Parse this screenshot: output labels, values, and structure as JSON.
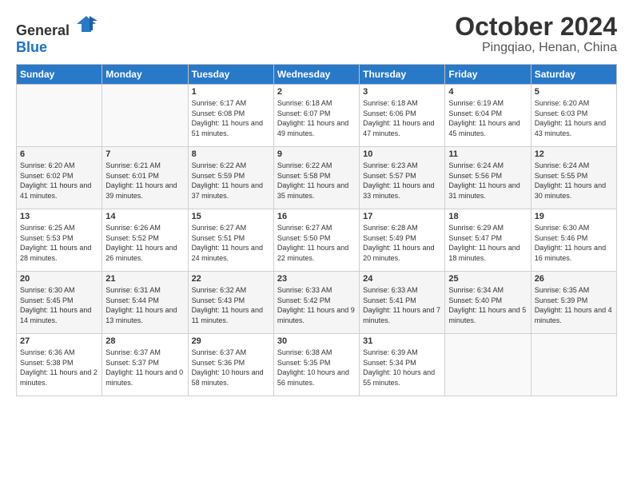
{
  "logo": {
    "general": "General",
    "blue": "Blue"
  },
  "header": {
    "month": "October 2024",
    "location": "Pingqiao, Henan, China"
  },
  "weekdays": [
    "Sunday",
    "Monday",
    "Tuesday",
    "Wednesday",
    "Thursday",
    "Friday",
    "Saturday"
  ],
  "weeks": [
    [
      {
        "day": "",
        "sunrise": "",
        "sunset": "",
        "daylight": ""
      },
      {
        "day": "",
        "sunrise": "",
        "sunset": "",
        "daylight": ""
      },
      {
        "day": "1",
        "sunrise": "Sunrise: 6:17 AM",
        "sunset": "Sunset: 6:08 PM",
        "daylight": "Daylight: 11 hours and 51 minutes."
      },
      {
        "day": "2",
        "sunrise": "Sunrise: 6:18 AM",
        "sunset": "Sunset: 6:07 PM",
        "daylight": "Daylight: 11 hours and 49 minutes."
      },
      {
        "day": "3",
        "sunrise": "Sunrise: 6:18 AM",
        "sunset": "Sunset: 6:06 PM",
        "daylight": "Daylight: 11 hours and 47 minutes."
      },
      {
        "day": "4",
        "sunrise": "Sunrise: 6:19 AM",
        "sunset": "Sunset: 6:04 PM",
        "daylight": "Daylight: 11 hours and 45 minutes."
      },
      {
        "day": "5",
        "sunrise": "Sunrise: 6:20 AM",
        "sunset": "Sunset: 6:03 PM",
        "daylight": "Daylight: 11 hours and 43 minutes."
      }
    ],
    [
      {
        "day": "6",
        "sunrise": "Sunrise: 6:20 AM",
        "sunset": "Sunset: 6:02 PM",
        "daylight": "Daylight: 11 hours and 41 minutes."
      },
      {
        "day": "7",
        "sunrise": "Sunrise: 6:21 AM",
        "sunset": "Sunset: 6:01 PM",
        "daylight": "Daylight: 11 hours and 39 minutes."
      },
      {
        "day": "8",
        "sunrise": "Sunrise: 6:22 AM",
        "sunset": "Sunset: 5:59 PM",
        "daylight": "Daylight: 11 hours and 37 minutes."
      },
      {
        "day": "9",
        "sunrise": "Sunrise: 6:22 AM",
        "sunset": "Sunset: 5:58 PM",
        "daylight": "Daylight: 11 hours and 35 minutes."
      },
      {
        "day": "10",
        "sunrise": "Sunrise: 6:23 AM",
        "sunset": "Sunset: 5:57 PM",
        "daylight": "Daylight: 11 hours and 33 minutes."
      },
      {
        "day": "11",
        "sunrise": "Sunrise: 6:24 AM",
        "sunset": "Sunset: 5:56 PM",
        "daylight": "Daylight: 11 hours and 31 minutes."
      },
      {
        "day": "12",
        "sunrise": "Sunrise: 6:24 AM",
        "sunset": "Sunset: 5:55 PM",
        "daylight": "Daylight: 11 hours and 30 minutes."
      }
    ],
    [
      {
        "day": "13",
        "sunrise": "Sunrise: 6:25 AM",
        "sunset": "Sunset: 5:53 PM",
        "daylight": "Daylight: 11 hours and 28 minutes."
      },
      {
        "day": "14",
        "sunrise": "Sunrise: 6:26 AM",
        "sunset": "Sunset: 5:52 PM",
        "daylight": "Daylight: 11 hours and 26 minutes."
      },
      {
        "day": "15",
        "sunrise": "Sunrise: 6:27 AM",
        "sunset": "Sunset: 5:51 PM",
        "daylight": "Daylight: 11 hours and 24 minutes."
      },
      {
        "day": "16",
        "sunrise": "Sunrise: 6:27 AM",
        "sunset": "Sunset: 5:50 PM",
        "daylight": "Daylight: 11 hours and 22 minutes."
      },
      {
        "day": "17",
        "sunrise": "Sunrise: 6:28 AM",
        "sunset": "Sunset: 5:49 PM",
        "daylight": "Daylight: 11 hours and 20 minutes."
      },
      {
        "day": "18",
        "sunrise": "Sunrise: 6:29 AM",
        "sunset": "Sunset: 5:47 PM",
        "daylight": "Daylight: 11 hours and 18 minutes."
      },
      {
        "day": "19",
        "sunrise": "Sunrise: 6:30 AM",
        "sunset": "Sunset: 5:46 PM",
        "daylight": "Daylight: 11 hours and 16 minutes."
      }
    ],
    [
      {
        "day": "20",
        "sunrise": "Sunrise: 6:30 AM",
        "sunset": "Sunset: 5:45 PM",
        "daylight": "Daylight: 11 hours and 14 minutes."
      },
      {
        "day": "21",
        "sunrise": "Sunrise: 6:31 AM",
        "sunset": "Sunset: 5:44 PM",
        "daylight": "Daylight: 11 hours and 13 minutes."
      },
      {
        "day": "22",
        "sunrise": "Sunrise: 6:32 AM",
        "sunset": "Sunset: 5:43 PM",
        "daylight": "Daylight: 11 hours and 11 minutes."
      },
      {
        "day": "23",
        "sunrise": "Sunrise: 6:33 AM",
        "sunset": "Sunset: 5:42 PM",
        "daylight": "Daylight: 11 hours and 9 minutes."
      },
      {
        "day": "24",
        "sunrise": "Sunrise: 6:33 AM",
        "sunset": "Sunset: 5:41 PM",
        "daylight": "Daylight: 11 hours and 7 minutes."
      },
      {
        "day": "25",
        "sunrise": "Sunrise: 6:34 AM",
        "sunset": "Sunset: 5:40 PM",
        "daylight": "Daylight: 11 hours and 5 minutes."
      },
      {
        "day": "26",
        "sunrise": "Sunrise: 6:35 AM",
        "sunset": "Sunset: 5:39 PM",
        "daylight": "Daylight: 11 hours and 4 minutes."
      }
    ],
    [
      {
        "day": "27",
        "sunrise": "Sunrise: 6:36 AM",
        "sunset": "Sunset: 5:38 PM",
        "daylight": "Daylight: 11 hours and 2 minutes."
      },
      {
        "day": "28",
        "sunrise": "Sunrise: 6:37 AM",
        "sunset": "Sunset: 5:37 PM",
        "daylight": "Daylight: 11 hours and 0 minutes."
      },
      {
        "day": "29",
        "sunrise": "Sunrise: 6:37 AM",
        "sunset": "Sunset: 5:36 PM",
        "daylight": "Daylight: 10 hours and 58 minutes."
      },
      {
        "day": "30",
        "sunrise": "Sunrise: 6:38 AM",
        "sunset": "Sunset: 5:35 PM",
        "daylight": "Daylight: 10 hours and 56 minutes."
      },
      {
        "day": "31",
        "sunrise": "Sunrise: 6:39 AM",
        "sunset": "Sunset: 5:34 PM",
        "daylight": "Daylight: 10 hours and 55 minutes."
      },
      {
        "day": "",
        "sunrise": "",
        "sunset": "",
        "daylight": ""
      },
      {
        "day": "",
        "sunrise": "",
        "sunset": "",
        "daylight": ""
      }
    ]
  ]
}
